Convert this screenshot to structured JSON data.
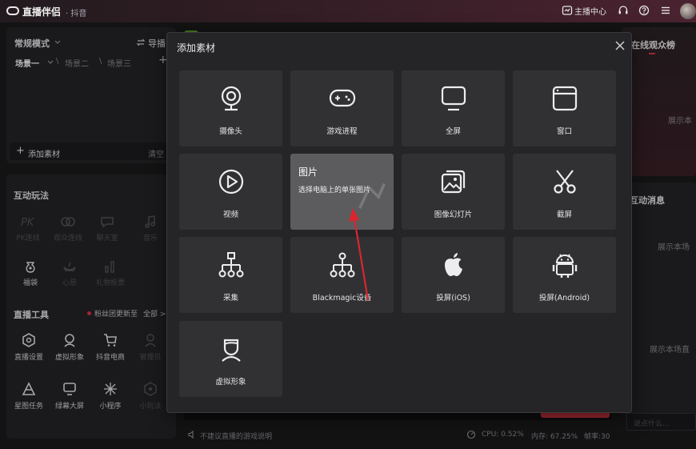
{
  "app": {
    "title": "直播伴侣",
    "subtitle": "· 抖音",
    "broadcaster_center": "主播中心"
  },
  "left": {
    "mode": "常规模式",
    "import_label": "导播",
    "scenes": [
      "场景一",
      "场景二",
      "场景三"
    ],
    "add_scene": "+",
    "add_material": "添加素材",
    "clear": "清空",
    "interaction_title": "互动玩法",
    "interactions": [
      {
        "label": "PK连线",
        "icon": "pk-icon"
      },
      {
        "label": "观众连线",
        "icon": "link-icon"
      },
      {
        "label": "聊天室",
        "icon": "chat-icon"
      },
      {
        "label": "音乐",
        "icon": "music-icon"
      },
      {
        "label": "福袋",
        "icon": "lucky-bag-icon"
      },
      {
        "label": "心愿",
        "icon": "wish-icon"
      },
      {
        "label": "礼物投票",
        "icon": "vote-icon"
      }
    ],
    "tools_title": "直播工具",
    "fans_update": "粉丝团更新至",
    "all_label": "全部 >",
    "tools": [
      {
        "label": "直播设置",
        "icon": "hexagon-settings-icon"
      },
      {
        "label": "虚拟形象",
        "icon": "avatar-icon"
      },
      {
        "label": "抖音电商",
        "icon": "cart-icon"
      },
      {
        "label": "管理员",
        "icon": "admin-icon"
      },
      {
        "label": "星图任务",
        "icon": "star-task-icon"
      },
      {
        "label": "绿幕大屏",
        "icon": "monitor-icon"
      },
      {
        "label": "小程序",
        "icon": "miniapp-icon"
      },
      {
        "label": "小玩法",
        "icon": "minigame-icon"
      }
    ]
  },
  "right": {
    "audience_title": "在线观众榜",
    "audience_empty": "展示本",
    "messages_title": "互动消息",
    "messages_empty": "展示本场",
    "gifts_empty": "展示本场直",
    "chat_placeholder": "说点什么..."
  },
  "status": {
    "notice": "不建议直播的游戏说明",
    "cpu": "CPU: 0.52%",
    "memory": "内存: 67.25%",
    "fps": "帧率:30"
  },
  "modal": {
    "title": "添加素材",
    "tiles": [
      {
        "label": "摄像头",
        "icon": "camera-icon"
      },
      {
        "label": "游戏进程",
        "icon": "gamepad-icon"
      },
      {
        "label": "全屏",
        "icon": "fullscreen-monitor-icon"
      },
      {
        "label": "窗口",
        "icon": "window-icon"
      },
      {
        "label": "视频",
        "icon": "play-icon"
      },
      {
        "label": "图片",
        "icon": "image-icon",
        "hover_desc": "选择电脑上的单张图片"
      },
      {
        "label": "图像幻灯片",
        "icon": "slideshow-icon"
      },
      {
        "label": "截屏",
        "icon": "scissors-icon"
      },
      {
        "label": "采集",
        "icon": "capture-tree-icon"
      },
      {
        "label": "Blackmagic设备",
        "icon": "blackmagic-tree-icon"
      },
      {
        "label": "投屏(iOS)",
        "icon": "apple-icon"
      },
      {
        "label": "投屏(Android)",
        "icon": "android-icon"
      },
      {
        "label": "虚拟形象",
        "icon": "virtual-avatar-icon"
      }
    ]
  },
  "colors": {
    "accent_red": "#e03545",
    "annotation_arrow": "#d9262c"
  }
}
